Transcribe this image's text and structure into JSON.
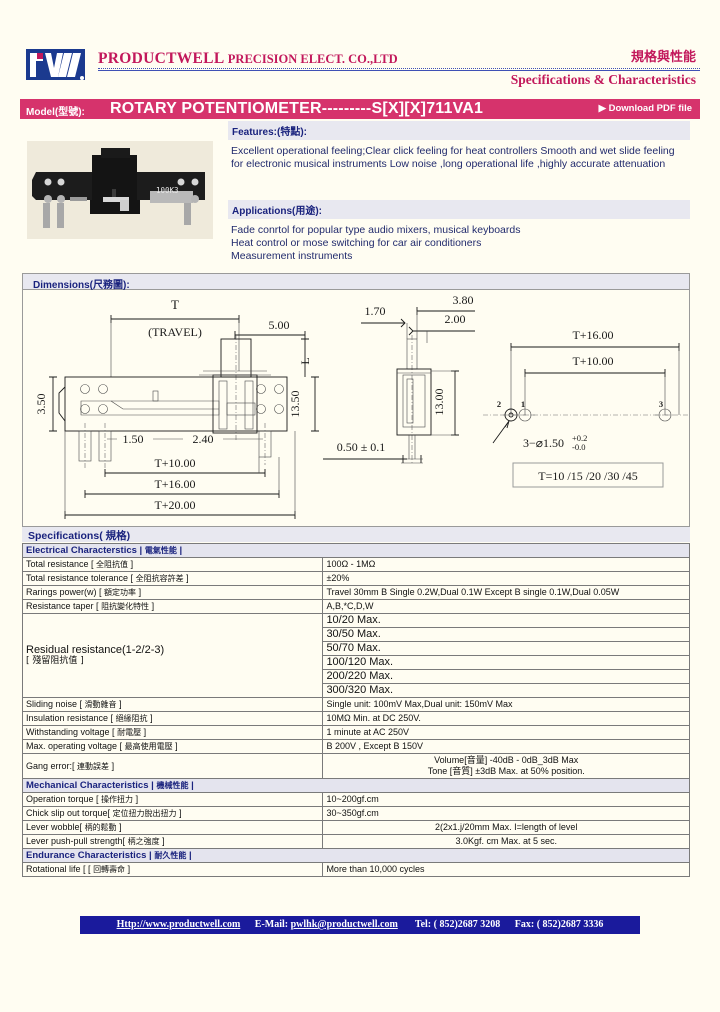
{
  "header": {
    "logo_text": "PW",
    "company_main": "PRODUCTWELL",
    "company_sub": "PRECISION  ELECT.  CO.,LTD",
    "cn_title": "規格與性能",
    "spec_title": "Specifications & Characteristics",
    "accent_color": "#c2185b"
  },
  "model_bar": {
    "label": "Model(型號):",
    "value": "ROTARY  POTENTIOMETER---------S[X][X]711VA1",
    "download_label": "Download PDF file",
    "bar_color": "#d6336c"
  },
  "features": {
    "heading": "Features:(特點):",
    "text": "Excellent operational feeling;Clear click feeling for heat controllers Smooth and wet slide feeling for electronic musical instruments Low noise ,long operational life ,highly accurate attenuation"
  },
  "applications": {
    "heading": "Applications(用途):",
    "lines": [
      "Fade conrtol for popular type audio mixers, musical keyboards",
      "Heat control or mose switching for car air conditioners",
      "Measurement instruments"
    ]
  },
  "photo": {
    "label": "100K3",
    "alt_name": "slide-potentiometer-photo"
  },
  "dimensions": {
    "heading": "Dimensions(尺務圖):",
    "labels": {
      "t": "T",
      "travel": "(TRAVEL)",
      "five": "5.00",
      "l": "L",
      "three_fifty": "3.50",
      "thirteen_fifty": "13.50",
      "one_fifty": "1.50",
      "two_forty": "2.40",
      "t_plus_10": "T+10.00",
      "t_plus_16": "T+16.00",
      "t_plus_20": "T+20.00",
      "one_seventy": "1.70",
      "three_eighty": "3.80",
      "two_zero_zero": "2.00",
      "thirteen_zero_zero": "13.00",
      "zero_fifty": "0.50 ± 0.1",
      "t_plus_16_r": "T+16.00",
      "t_plus_10_r": "T+10.00",
      "pin2": "2",
      "pin1": "1",
      "pin3": "3",
      "hole_note": "3−⌀3D1.50",
      "hole_note_main": "3−⌀1.50",
      "hole_tol_up": "+0.2",
      "hole_tol_dn": "-0.0",
      "t_values": "T=10 /15 /20 /30 /45"
    }
  },
  "specifications": {
    "section_title": "Specifications( 規格)",
    "groups": [
      {
        "title": "Electrical Characterstics",
        "title_cn": "電氣性能",
        "rows": [
          {
            "label": "Total resistance [",
            "label_cn": "全阻抗值",
            "label_end": "]",
            "value": "100Ω - 1MΩ"
          },
          {
            "label": "Total resistance tolerance [",
            "label_cn": "全阻抗容許差",
            "label_end": "]",
            "value": "±20%"
          },
          {
            "label": "Rarings power(w) [",
            "label_cn": "額定功率",
            "label_end": "]",
            "value": "Travel  30mm   B  Single 0.2W,Dual 0.1W       Except B  single 0.1W,Dual 0.05W"
          },
          {
            "label": "Resistance taper [",
            "label_cn": "阻抗變化特性",
            "label_end": "]",
            "value": "A,B,*C,D,W"
          }
        ]
      },
      {
        "residual": {
          "label": "Residual resistance(1-2/2-3)",
          "label_cn": "[ 殘留阻抗值 ]",
          "values": [
            "10/20 Max.",
            "30/50 Max.",
            "50/70 Max.",
            "100/120 Max.",
            "200/220 Max.",
            "300/320 Max."
          ]
        }
      },
      {
        "rows2": [
          {
            "label": "Sliding noise [",
            "label_cn": "滑動雜音",
            "label_end": "]",
            "value": "Single unit: 100mV  Max,Dual unit: 150mV Max"
          },
          {
            "label": "Insulation resistance [",
            "label_cn": "絕緣阻抗",
            "label_end": "]",
            "value": "10MΩ Min. at DC 250V."
          },
          {
            "label": "Withstanding voltage [",
            "label_cn": "耐電壓",
            "label_end": "]",
            "value": "1 minute at AC 250V"
          },
          {
            "label": "Max. operating voltage [",
            "label_cn": "最高使用電壓",
            "label_end": "]",
            "value": "B 200V  , Except B  150V"
          }
        ],
        "gang": {
          "label": "Gang error:[",
          "label_cn": "連動誤差",
          "label_end": "]",
          "line1": "Volume[音量]      -40dB - 0dB_3dB Max",
          "line2": "Tone [音質]     ±3dB Max. at 50% position."
        }
      },
      {
        "title": "Mechanical Characteristics",
        "title_cn": "機械性能",
        "rows": [
          {
            "label": "Operation torque [",
            "label_cn": "操作扭力",
            "label_end": "]",
            "value": "10~200gf.cm"
          },
          {
            "label": "Chick slip out torque[",
            "label_cn": "定位扭力脫出扭力",
            "label_end": "]",
            "value": "30~350gf.cm"
          },
          {
            "label": "Lever wobble[",
            "label_cn": "柄的鬆動",
            "label_end": "]",
            "value": "2(2x1.j/20mm Max. I=length of level",
            "center": true
          },
          {
            "label": "Lever push-pull strength[",
            "label_cn": "柄之強度",
            "label_end": "]",
            "value": "3.0Kgf. cm Max. at 5 sec.",
            "center": true
          }
        ]
      },
      {
        "title": "Endurance Characteristics",
        "title_cn": "耐久性能",
        "rows": [
          {
            "label": "Rotational life [ [",
            "label_cn": "回轉壽命",
            "label_end": "]",
            "value": "More than 10,000 cycles"
          }
        ]
      }
    ]
  },
  "footer": {
    "site_prefix": "Http://",
    "site": "www.productwell.com",
    "email_label": "E-Mail:",
    "email": "pwlhk@productwell.com",
    "tel": "Tel: ( 852)2687 3208",
    "fax": "Fax: ( 852)2687 3336",
    "bg_color": "#1a1a9c"
  }
}
